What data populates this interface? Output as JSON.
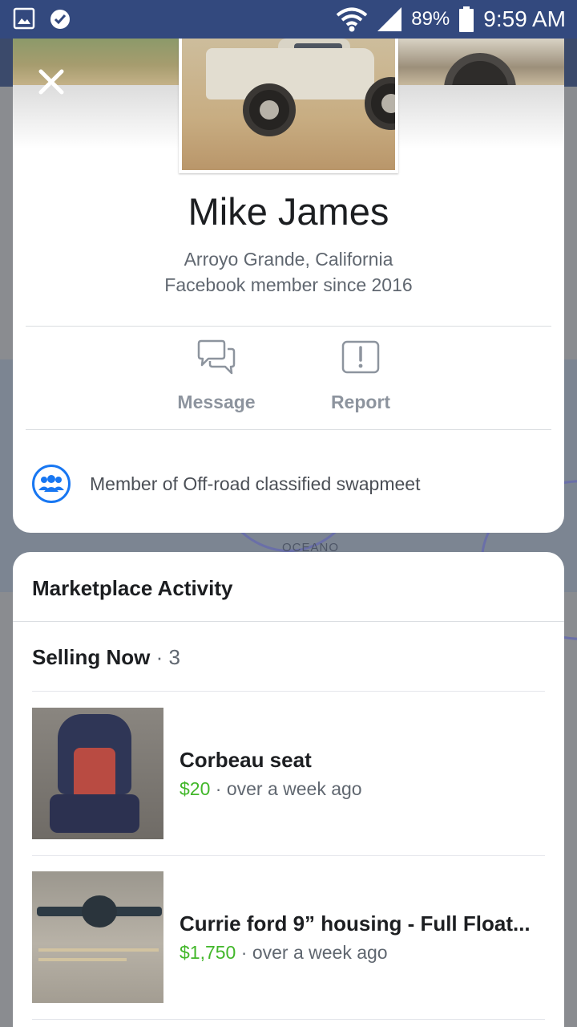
{
  "status_bar": {
    "battery_percent": "89%",
    "time": "9:59 AM",
    "icons": [
      "gallery-icon",
      "tasks-icon",
      "wifi-icon",
      "signal-icon",
      "battery-icon"
    ]
  },
  "profile": {
    "close_icon": "close-icon",
    "name": "Mike James",
    "location": "Arroyo Grande, California",
    "member_since": "Facebook member since 2016",
    "actions": [
      {
        "label": "Message",
        "icon": "message-icon"
      },
      {
        "label": "Report",
        "icon": "report-icon"
      }
    ],
    "group": {
      "icon": "group-icon",
      "text": "Member of Off-road classified swapmeet"
    }
  },
  "background": {
    "map_label": "OCEANO"
  },
  "marketplace": {
    "title": "Marketplace Activity",
    "selling": {
      "label": "Selling Now",
      "separator": "·",
      "count": "3"
    },
    "listings": [
      {
        "title": "Corbeau seat",
        "price": "$20",
        "separator": "·",
        "time": "over a week ago"
      },
      {
        "title": "Currie ford 9” housing - Full Float...",
        "price": "$1,750",
        "separator": "·",
        "time": "over a week ago"
      }
    ]
  },
  "colors": {
    "status_bar": "#33497e",
    "accent_blue": "#1877f2",
    "price_green": "#42b72a",
    "secondary_text": "#606770"
  }
}
